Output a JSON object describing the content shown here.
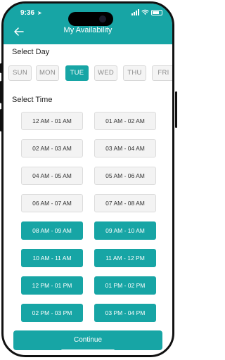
{
  "status_bar": {
    "time": "9:36"
  },
  "header": {
    "title": "My Availability",
    "back_icon": "arrow-left-icon"
  },
  "day_section": {
    "title": "Select Day"
  },
  "days": [
    {
      "label": "SUN",
      "selected": false
    },
    {
      "label": "MON",
      "selected": false
    },
    {
      "label": "TUE",
      "selected": true
    },
    {
      "label": "WED",
      "selected": false
    },
    {
      "label": "THU",
      "selected": false
    },
    {
      "label": "FRI",
      "selected": false
    }
  ],
  "time_section": {
    "title": "Select Time"
  },
  "slots": [
    {
      "label": "12 AM - 01 AM",
      "selected": false
    },
    {
      "label": "01 AM - 02 AM",
      "selected": false
    },
    {
      "label": "02 AM - 03 AM",
      "selected": false
    },
    {
      "label": "03 AM - 04 AM",
      "selected": false
    },
    {
      "label": "04 AM - 05 AM",
      "selected": false
    },
    {
      "label": "05 AM - 06 AM",
      "selected": false
    },
    {
      "label": "06 AM - 07 AM",
      "selected": false
    },
    {
      "label": "07 AM - 08 AM",
      "selected": false
    },
    {
      "label": "08 AM - 09 AM",
      "selected": true
    },
    {
      "label": "09 AM - 10 AM",
      "selected": true
    },
    {
      "label": "10 AM - 11 AM",
      "selected": true
    },
    {
      "label": "11 AM - 12 PM",
      "selected": true
    },
    {
      "label": "12 PM - 01 PM",
      "selected": true
    },
    {
      "label": "01 PM - 02 PM",
      "selected": true
    },
    {
      "label": "02 PM - 03 PM",
      "selected": true
    },
    {
      "label": "03 PM - 04 PM",
      "selected": true
    }
  ],
  "footer": {
    "continue_label": "Continue"
  },
  "colors": {
    "accent": "#17a5a5",
    "unselected_bg": "#f3f3f3"
  }
}
